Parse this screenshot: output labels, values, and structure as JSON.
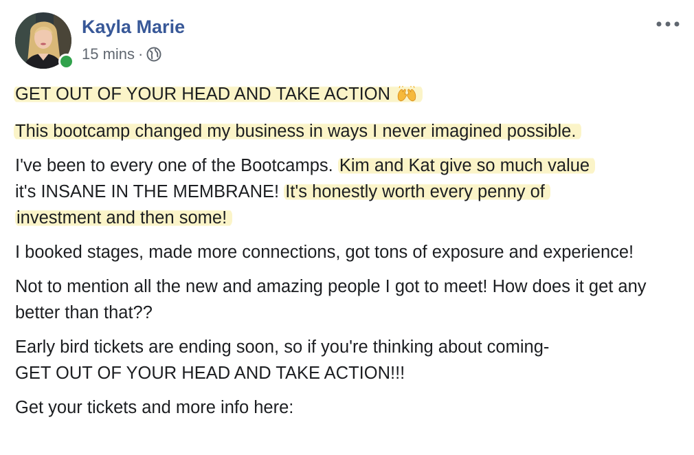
{
  "post": {
    "author": {
      "name": "Kayla Marie",
      "online_status_color": "#31a24c"
    },
    "timestamp": "15 mins",
    "separator": "·",
    "audience_icon": "globe-icon",
    "menu_icon": "more-horizontal-icon",
    "highlight_color": "#fbf4c8",
    "link_color": "#385898",
    "paragraphs": {
      "p1": {
        "text": "GET OUT OF YOUR HEAD AND TAKE ACTION",
        "emoji_icon": "raising-hands-emoji"
      },
      "p2": {
        "text": "This bootcamp changed my business in ways I never imagined possible."
      },
      "p3": {
        "part1": "I've been to every one of the Bootcamps. ",
        "part2": "Kim and Kat give so much value",
        "part3": "it's INSANE IN THE MEMBRANE! ",
        "part4": "It's honestly worth every penny of investment and then some!"
      },
      "p4": {
        "text": "I booked stages, made more connections, got tons of exposure and experience!"
      },
      "p5": {
        "text": "Not to mention all the new and amazing people I got to meet! How does it get any better than that??"
      },
      "p6": {
        "line1": "Early bird tickets are ending soon, so if you're thinking about coming-",
        "line2": "GET OUT OF YOUR HEAD AND TAKE ACTION!!!"
      },
      "p7": {
        "text": "Get your tickets and more info here:"
      }
    }
  }
}
